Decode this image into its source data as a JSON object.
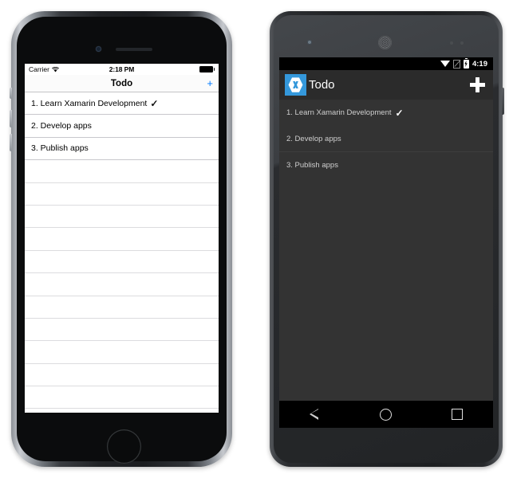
{
  "ios": {
    "status_bar": {
      "carrier": "Carrier",
      "wifi_icon": "wifi-icon",
      "time": "2:18 PM",
      "battery_icon": "battery-full-icon"
    },
    "nav_bar": {
      "title": "Todo",
      "add_label": "+"
    },
    "list": {
      "items": [
        {
          "text": "1. Learn Xamarin Development",
          "done": true,
          "check": "✓"
        },
        {
          "text": "2. Develop apps",
          "done": false,
          "check": ""
        },
        {
          "text": "3. Publish apps",
          "done": false,
          "check": ""
        }
      ],
      "empty_row_count": 13
    },
    "home_button": "home-button"
  },
  "android": {
    "status_bar": {
      "wifi_icon": "wifi-icon",
      "signal_icon": "no-sim-icon",
      "battery_icon": "battery-charging-icon",
      "battery_glyph": "⚡",
      "time": "4:19"
    },
    "toolbar": {
      "app_icon": "xamarin-logo-icon",
      "title": "Todo",
      "add_label": "add-icon"
    },
    "list": {
      "items": [
        {
          "text": "1. Learn Xamarin Development",
          "done": true,
          "check": "✓"
        },
        {
          "text": "2. Develop apps",
          "done": false,
          "check": ""
        },
        {
          "text": "3. Publish apps",
          "done": false,
          "check": ""
        }
      ]
    },
    "nav_bar": {
      "back": "back-icon",
      "home": "home-icon",
      "recents": "recents-icon"
    }
  },
  "colors": {
    "ios_accent": "#007aff",
    "xamarin_blue": "#3498db",
    "android_list_bg": "#333333",
    "android_toolbar_bg": "#2b2b2b",
    "android_text": "#cfcfcf"
  }
}
